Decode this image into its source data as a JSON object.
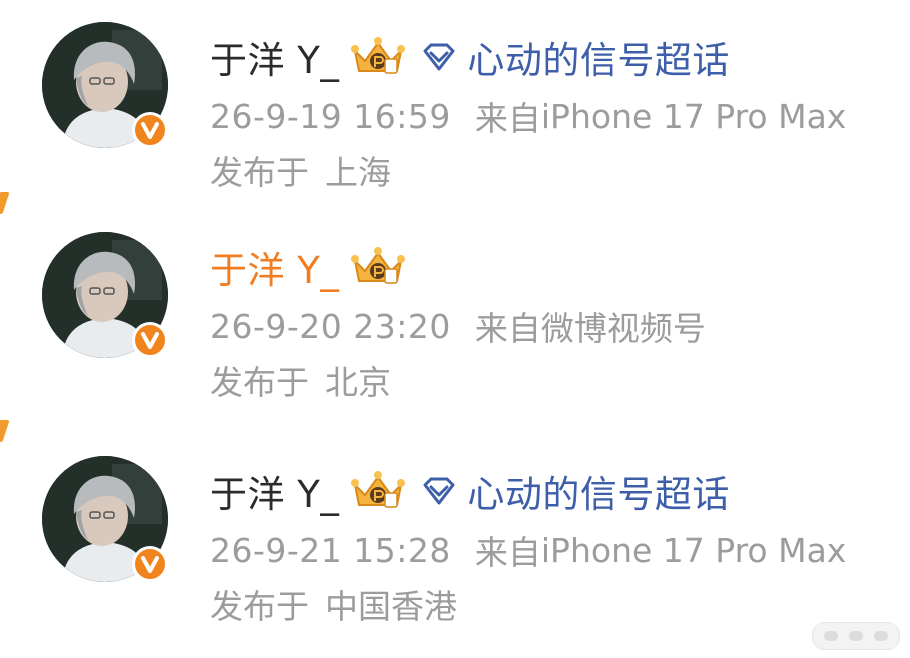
{
  "colors": {
    "name_default": "#2b2b2b",
    "name_highlight": "#f07d21",
    "topic_link": "#3d5ea8",
    "meta_gray": "#9c9c9c",
    "verify_badge": "#f1851d"
  },
  "posts": [
    {
      "username": "于洋 Y_",
      "name_highlighted": false,
      "member_badge_icon": "crown-vip-icon",
      "topic": {
        "icon": "diamond-icon",
        "label": "心动的信号超话"
      },
      "time": "26-9-19 16:59",
      "source_prefix": "来自",
      "source_device": "iPhone 17 Pro Max",
      "location_label": "发布于",
      "location": "上海"
    },
    {
      "username": "于洋 Y_",
      "name_highlighted": true,
      "member_badge_icon": "crown-vip-icon",
      "topic": null,
      "time": "26-9-20 23:20",
      "source_prefix": "来自",
      "source_device": "微博视频号",
      "location_label": "发布于",
      "location": "北京"
    },
    {
      "username": "于洋 Y_",
      "name_highlighted": false,
      "member_badge_icon": "crown-vip-icon",
      "topic": {
        "icon": "diamond-icon",
        "label": "心动的信号超话"
      },
      "time": "26-9-21 15:28",
      "source_prefix": "来自",
      "source_device": "iPhone 17 Pro Max",
      "location_label": "发布于",
      "location": "中国香港"
    }
  ]
}
